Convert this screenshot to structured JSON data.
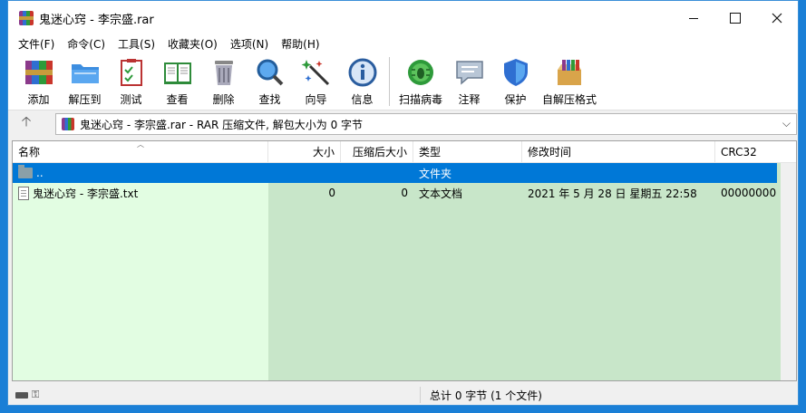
{
  "window": {
    "title": "鬼迷心窍 - 李宗盛.rar"
  },
  "menu": [
    "文件(F)",
    "命令(C)",
    "工具(S)",
    "收藏夹(O)",
    "选项(N)",
    "帮助(H)"
  ],
  "toolbar": [
    {
      "label": "添加",
      "icon": "add-archive-icon"
    },
    {
      "label": "解压到",
      "icon": "extract-to-icon"
    },
    {
      "label": "测试",
      "icon": "test-icon"
    },
    {
      "label": "查看",
      "icon": "view-book-icon"
    },
    {
      "label": "删除",
      "icon": "trash-icon"
    },
    {
      "label": "查找",
      "icon": "magnifier-icon"
    },
    {
      "label": "向导",
      "icon": "wand-icon"
    },
    {
      "label": "信息",
      "icon": "info-icon"
    },
    {
      "label": "扫描病毒",
      "icon": "virus-scan-icon"
    },
    {
      "label": "注释",
      "icon": "comment-icon"
    },
    {
      "label": "保护",
      "icon": "shield-icon"
    },
    {
      "label": "自解压格式",
      "icon": "sfx-icon"
    }
  ],
  "address": {
    "text": "鬼迷心窍 - 李宗盛.rar - RAR 压缩文件, 解包大小为 0 字节"
  },
  "columns": [
    "名称",
    "大小",
    "压缩后大小",
    "类型",
    "修改时间",
    "CRC32"
  ],
  "rows": [
    {
      "name": "..",
      "size": "",
      "packed": "",
      "type": "文件夹",
      "modified": "",
      "crc": "",
      "kind": "folder"
    },
    {
      "name": "鬼迷心窍 - 李宗盛.txt",
      "size": "0",
      "packed": "0",
      "type": "文本文档",
      "modified": "2021 年 5 月 28 日 星期五 22:58",
      "crc": "00000000",
      "kind": "text"
    }
  ],
  "status": {
    "summary": "总计 0 字节 (1 个文件)"
  },
  "colors": {
    "selection": "#0078d7",
    "list_bg": "#c8e6c9",
    "name_col_bg": "#e2fde2",
    "desktop": "#1a7fd6"
  }
}
